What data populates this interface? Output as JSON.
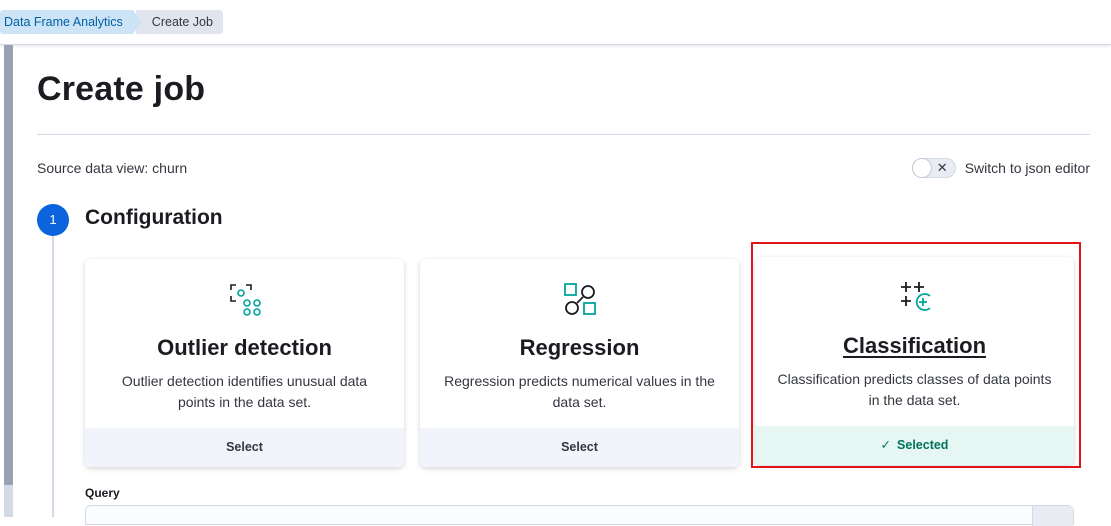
{
  "breadcrumbs": [
    "Data Frame Analytics",
    "Create Job"
  ],
  "page": {
    "title": "Create job",
    "source_data_view": "Source data view: churn",
    "json_editor_label": "Switch to json editor",
    "json_editor_enabled": false
  },
  "step": {
    "number": "1",
    "title": "Configuration"
  },
  "job_types": [
    {
      "title": "Outlier detection",
      "description": "Outlier detection identifies unusual data points in the data set.",
      "footer": "Select",
      "icon": "outlier-detection-icon",
      "selected": false
    },
    {
      "title": "Regression",
      "description": "Regression predicts numerical values in the data set.",
      "footer": "Select",
      "icon": "regression-icon",
      "selected": false
    },
    {
      "title": "Classification",
      "description": "Classification predicts classes of data points in the data set.",
      "footer": "Selected",
      "icon": "classification-icon",
      "selected": true
    }
  ],
  "query": {
    "label": "Query",
    "value": ""
  },
  "colors": {
    "accent": "#0b64dd",
    "icon_teal": "#00a69b",
    "selected_text": "#00725d",
    "highlight": "#e0141b"
  }
}
